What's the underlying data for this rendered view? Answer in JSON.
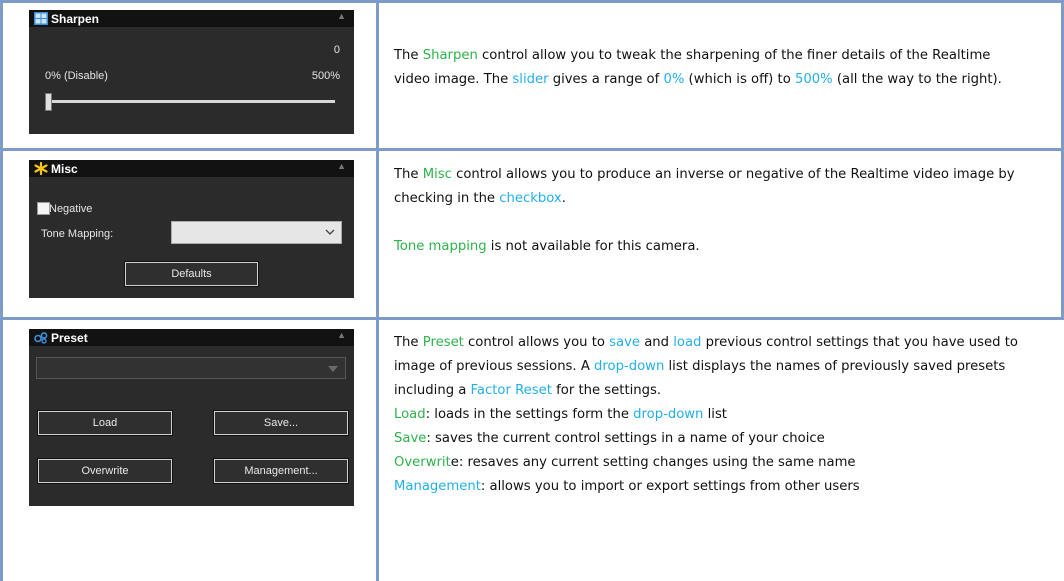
{
  "sharpen": {
    "panel": {
      "title": "Sharpen",
      "icon": "sharpen-icon",
      "value": "0",
      "min_label": "0% (Disable)",
      "max_label": "500%",
      "slider_fraction": 0.0
    },
    "desc": {
      "t1": "The ",
      "k1": "Sharpen",
      "t2": " control allow you to tweak the sharpening of the finer details of the Realtime video image. The ",
      "k2": "slider",
      "t3": " gives a range of ",
      "k3": "0%",
      "t4": " (which is off) to ",
      "k4": "500%",
      "t5": " (all the way to the right)."
    }
  },
  "misc": {
    "panel": {
      "title": "Misc",
      "icon": "asterisk-icon",
      "negative_label": "Negative",
      "negative_checked": false,
      "tone_label": "Tone Mapping:",
      "tone_value": "",
      "defaults_label": "Defaults"
    },
    "desc": {
      "t1": "The ",
      "k1": "Misc",
      "t2": " control allows you to produce an inverse or negative of the Realtime video image by checking in the ",
      "k2": "checkbox",
      "t3": ".",
      "k3": "Tone mapping",
      "t4": " is not available for this camera."
    }
  },
  "preset": {
    "panel": {
      "title": "Preset",
      "icon": "preset-icon",
      "selected": "",
      "load_label": "Load",
      "save_label": "Save...",
      "overwrite_label": "Overwrite",
      "management_label": "Management..."
    },
    "desc": {
      "t1": "The ",
      "k1": "Preset",
      "t2": " control allows you to ",
      "k2": "save",
      "t3": " and ",
      "k3": "load",
      "t4": " previous control settings that you have used to image of previous sessions. A ",
      "k4": "drop-down",
      "t5": " list displays the names of previously saved presets including a ",
      "k5": "Factor Reset",
      "t6": " for the settings.",
      "load_k": "Load",
      "load_t1": ": loads in the settings form the ",
      "load_k2": "drop-down",
      "load_t2": " list",
      "save_k": "Save",
      "save_t": ": saves the current control settings in a name of your choice",
      "over_k": "Overwrit",
      "over_t": "e: resaves any current setting changes using the same name",
      "mgmt_k": "Management",
      "mgmt_t": ": allows you to import or export settings from other users"
    }
  },
  "colors": {
    "grid": "#7c9bc7",
    "green_keyword": "#2db34a",
    "blue_keyword": "#22b0e6",
    "panel_bg": "#2b2b2b"
  }
}
